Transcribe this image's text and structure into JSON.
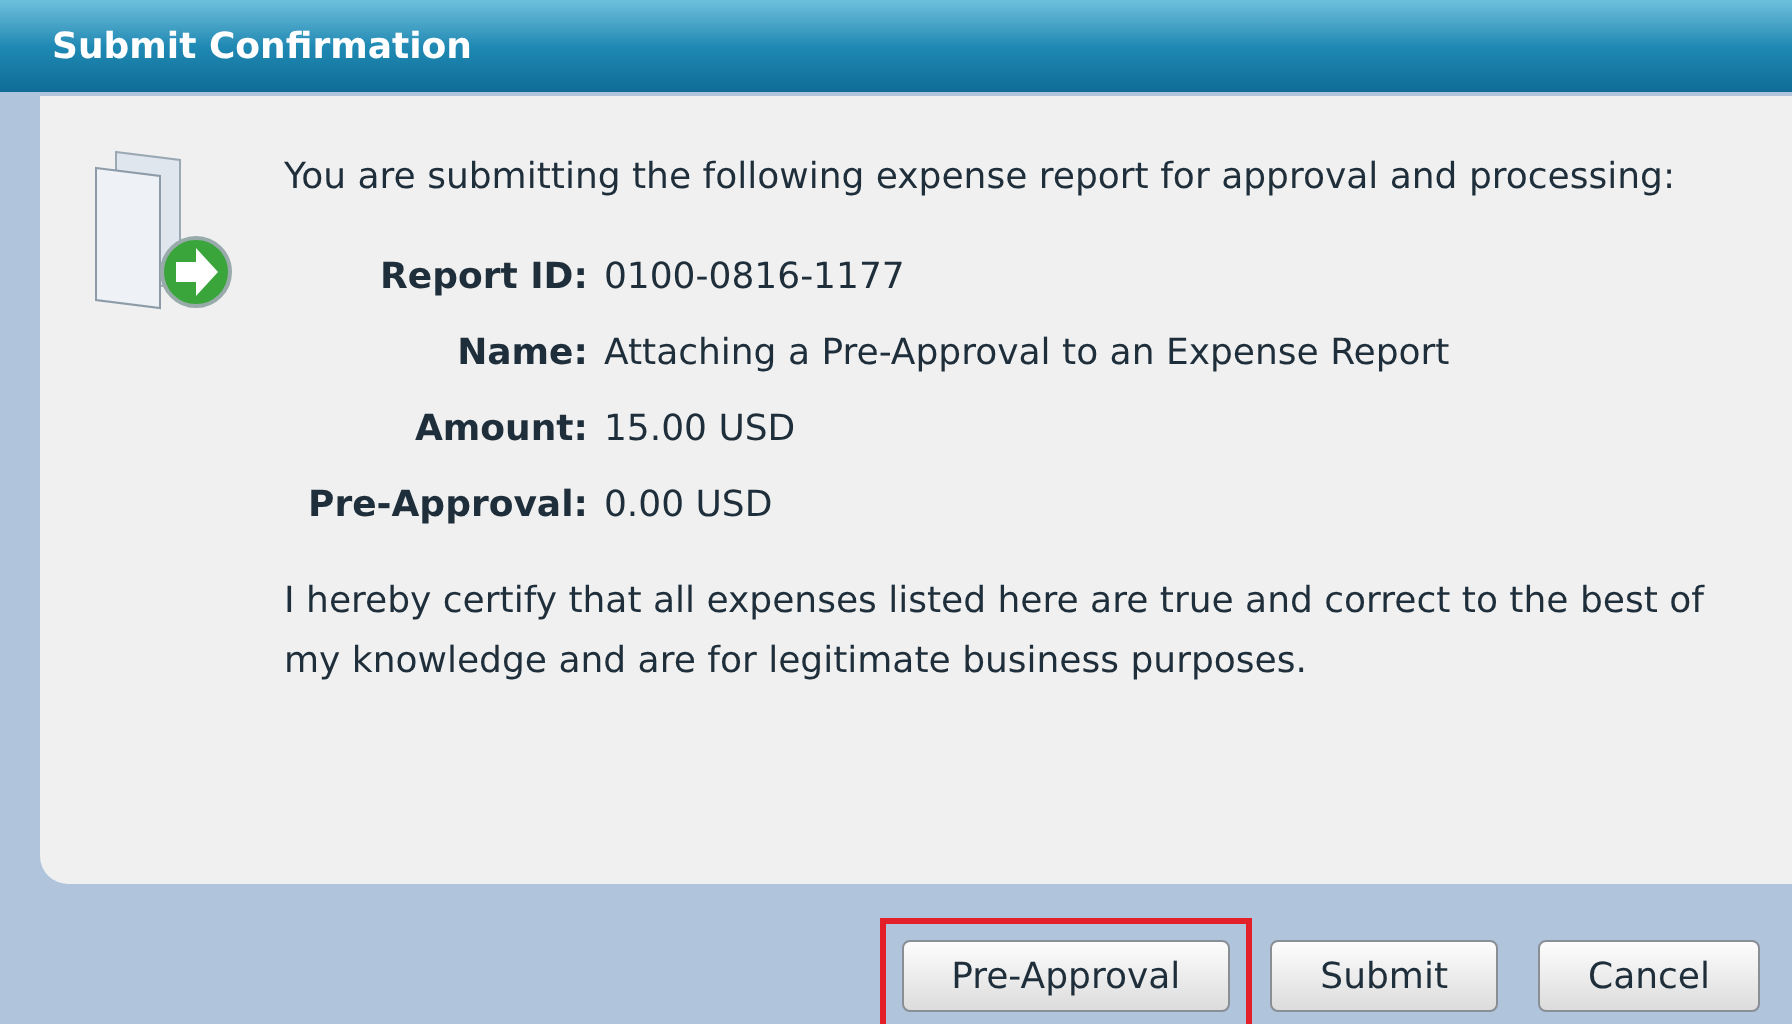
{
  "window": {
    "title": "Submit Confirmation"
  },
  "intro": "You are submitting the following expense report for approval and processing:",
  "fields": [
    {
      "label": "Report ID:",
      "value": "0100-0816-1177"
    },
    {
      "label": "Name:",
      "value": "Attaching a Pre-Approval to an Expense Report"
    },
    {
      "label": "Amount:",
      "value": "15.00 USD"
    },
    {
      "label": "Pre-Approval:",
      "value": "0.00 USD"
    }
  ],
  "certification": "I hereby certify that all expenses listed here are true and correct to the best of my knowledge and are for legitimate business purposes.",
  "buttons": [
    {
      "label": "Pre-Approval",
      "highlighted": true
    },
    {
      "label": "Submit",
      "highlighted": false
    },
    {
      "label": "Cancel",
      "highlighted": false
    }
  ]
}
